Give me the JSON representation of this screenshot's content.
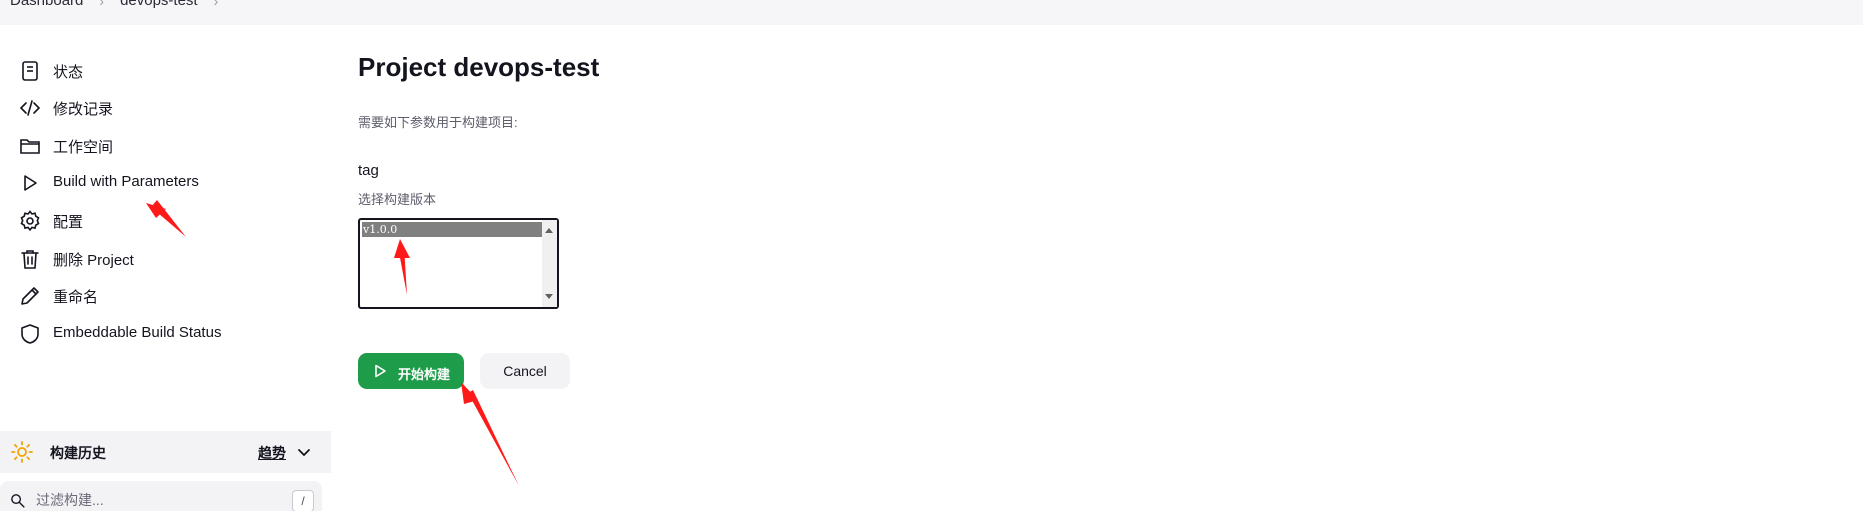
{
  "breadcrumb": {
    "items": [
      "Dashboard",
      "devops-test"
    ],
    "separator": "›"
  },
  "sidebar": {
    "items": [
      {
        "label": "状态",
        "icon": "document-icon"
      },
      {
        "label": "修改记录",
        "icon": "code-icon"
      },
      {
        "label": "工作空间",
        "icon": "folder-icon"
      },
      {
        "label": "Build with Parameters",
        "icon": "play-icon"
      },
      {
        "label": "配置",
        "icon": "gear-icon"
      },
      {
        "label": "删除 Project",
        "icon": "trash-icon"
      },
      {
        "label": "重命名",
        "icon": "pencil-icon"
      },
      {
        "label": "Embeddable Build Status",
        "icon": "shield-icon"
      }
    ],
    "build_history": {
      "title": "构建历史",
      "trend_label": "趋势",
      "filter_placeholder": "过滤构建...",
      "shortcut_key": "/"
    }
  },
  "main": {
    "title": "Project devops-test",
    "description": "需要如下参数用于构建项目:",
    "parameter": {
      "name": "tag",
      "description": "选择构建版本",
      "options": [
        "v1.0.0"
      ],
      "selected": "v1.0.0"
    },
    "build_button_label": "开始构建",
    "cancel_button_label": "Cancel"
  },
  "colors": {
    "build_button": "#1f9c4a",
    "annotation_arrow": "#ff1a1a",
    "breadcrumb_bg": "#f6f6f8",
    "panel_bg": "#f3f3f6"
  }
}
